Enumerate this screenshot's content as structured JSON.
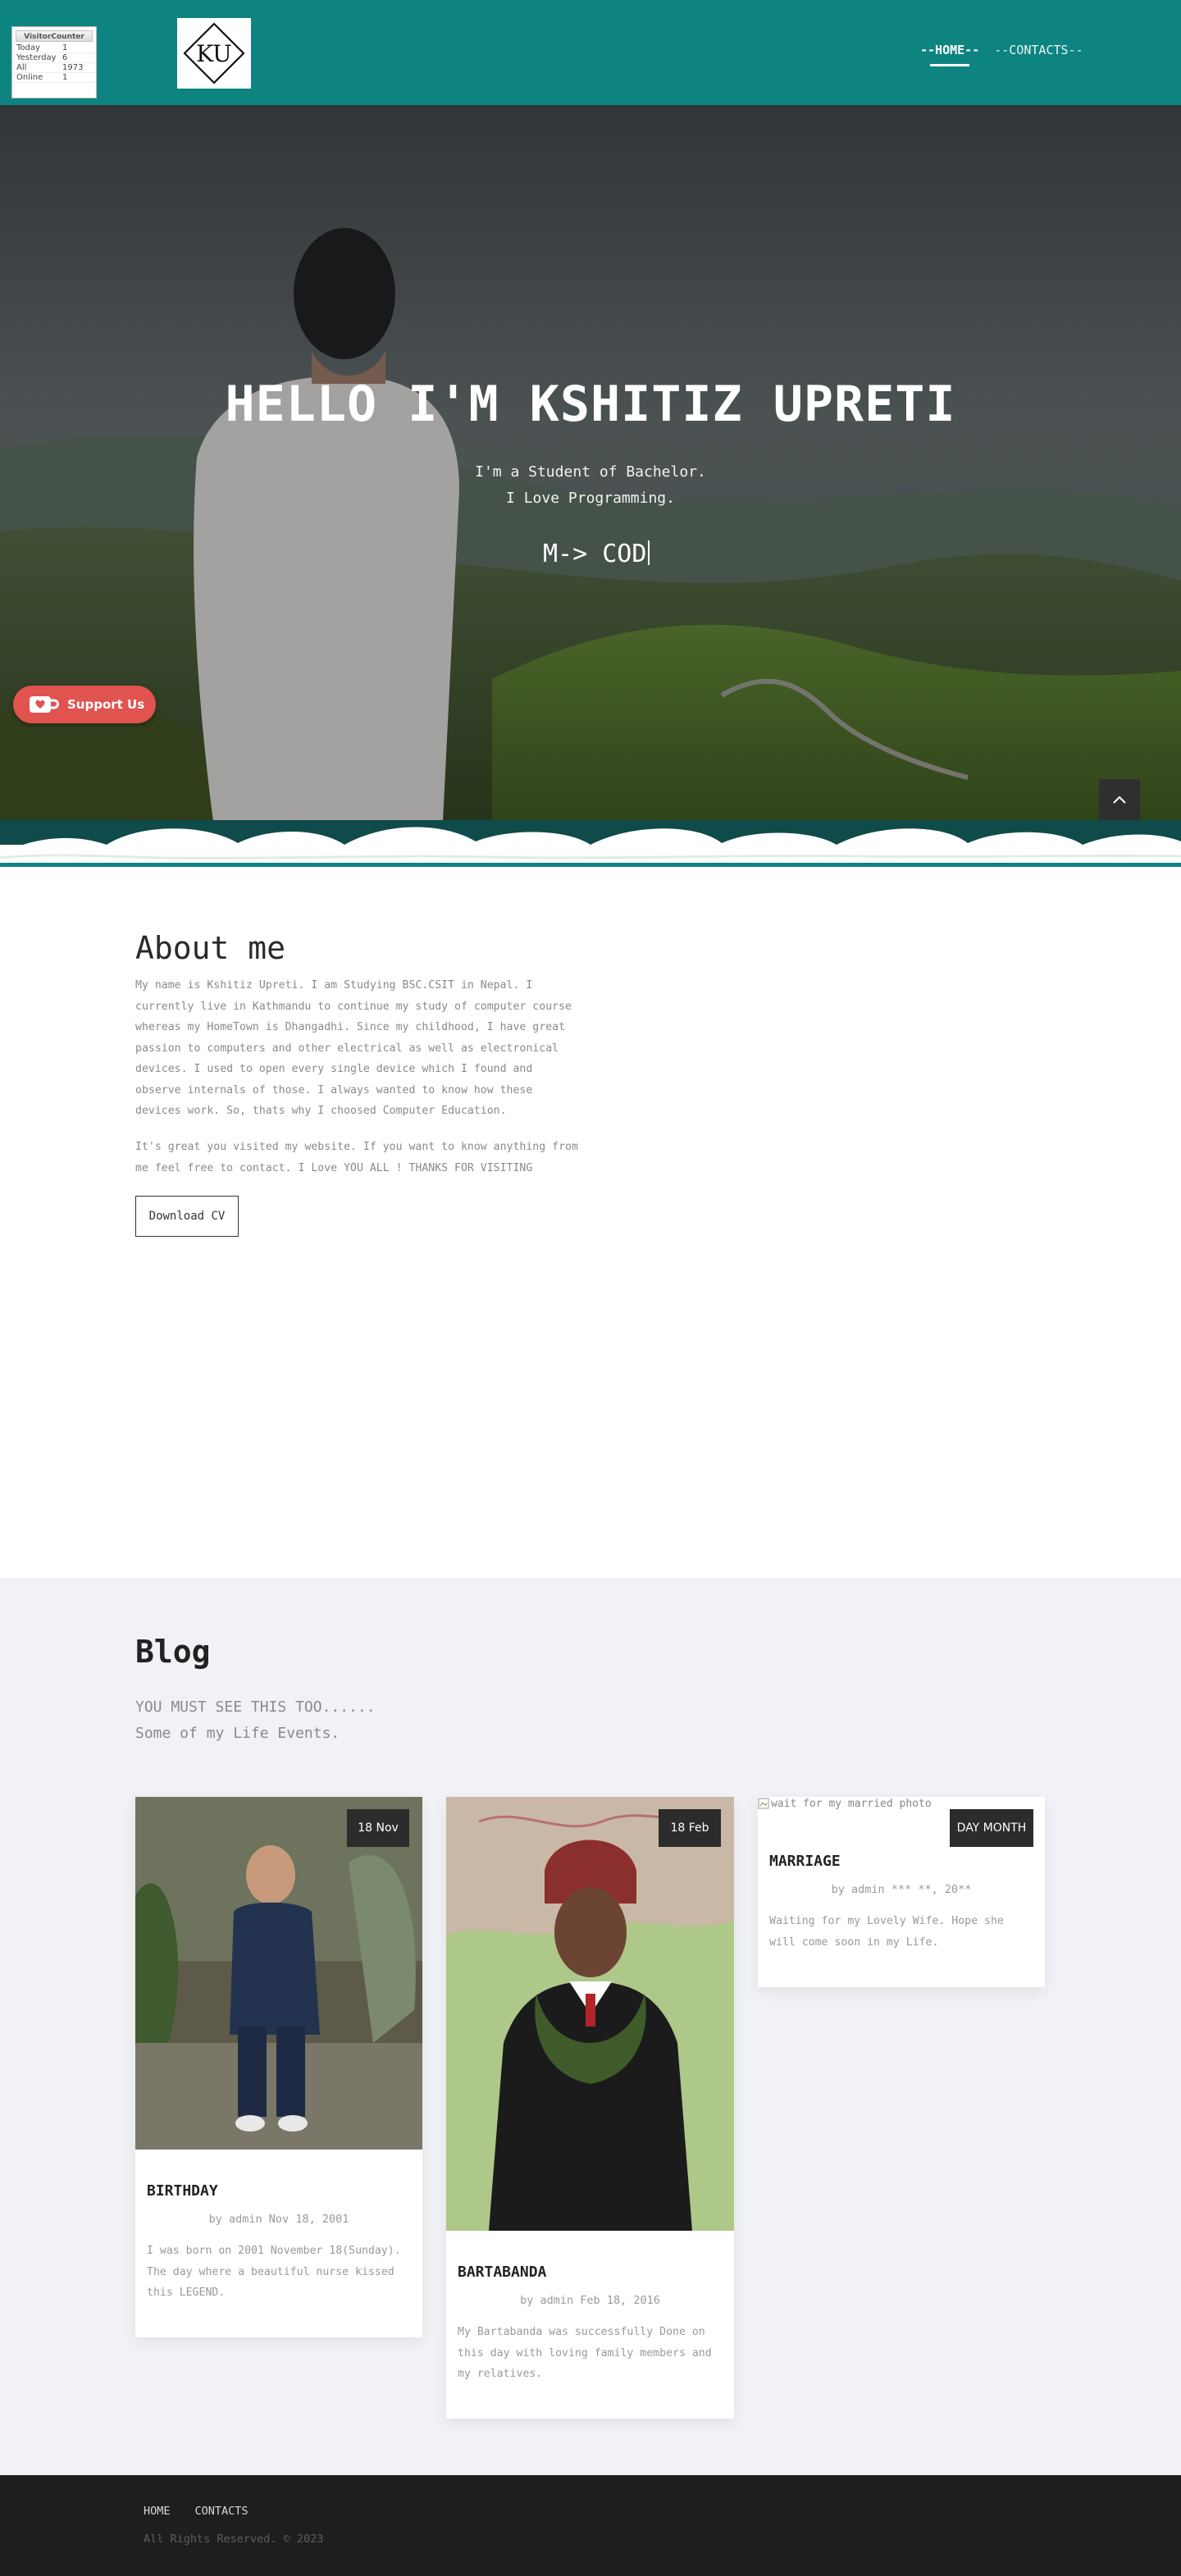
{
  "visitor_counter": {
    "title": "VisitorCounter",
    "rows": [
      {
        "label": "Today",
        "value": "1"
      },
      {
        "label": "Yesterday",
        "value": "6"
      },
      {
        "label": "All",
        "value": "1973"
      },
      {
        "label": "Online",
        "value": "1"
      }
    ]
  },
  "logo": {
    "text": "KU"
  },
  "nav": {
    "home": "--HOME--",
    "contacts": "--CONTACTS--"
  },
  "hero": {
    "title": "HELLO I'M KSHITIZ UPRETI",
    "line1": "I'm a Student of Bachelor.",
    "line2": "I Love Programming.",
    "typed": "M-> COD"
  },
  "support": {
    "label": "Support Us"
  },
  "about": {
    "title": "About me",
    "p1": "My name is Kshitiz Upreti. I am Studying BSC.CSIT in Nepal. I currently live in Kathmandu to continue my study of computer course whereas my HomeTown is Dhangadhi. Since my childhood, I have great passion to computers and other electrical as well as electronical devices. I used to open every single device which I found and observe internals of those. I always wanted to know how these devices work. So, thats why I choosed Computer Education.",
    "p2": "It's great you visited my website. If you want to know anything from me feel free to contact. I Love YOU ALL ! THANKS FOR VISITING",
    "cv_button": "Download CV"
  },
  "blog": {
    "title": "Blog",
    "sub1": "YOU MUST SEE THIS TOO......",
    "sub2": "Some of my Life Events.",
    "posts": [
      {
        "date": "18 Nov",
        "title": "BIRTHDAY",
        "meta": "by admin Nov 18, 2001",
        "body": "I was born on 2001 November 18(Sunday). The day where a beautiful nurse kissed this LEGEND."
      },
      {
        "date": "18 Feb",
        "title": "BARTABANDA",
        "meta": "by admin Feb 18, 2016",
        "body": "My Bartabanda was successfully Done on this day with loving family members and my relatives."
      },
      {
        "date": "DAY MONTH",
        "title": "MARRIAGE",
        "meta": "by admin *** **, 20**",
        "body": "Waiting for my Lovely Wife. Hope she will come soon in my Life.",
        "img_alt": "wait for my married photo"
      }
    ]
  },
  "footer": {
    "home": "HOME",
    "contacts": "CONTACTS",
    "copyright": "All Rights Reserved. © 2023"
  },
  "colors": {
    "header": "#0e8481",
    "footer": "#1e1e1e",
    "blog_bg": "#f1f2f6",
    "support": "#e0534f"
  }
}
